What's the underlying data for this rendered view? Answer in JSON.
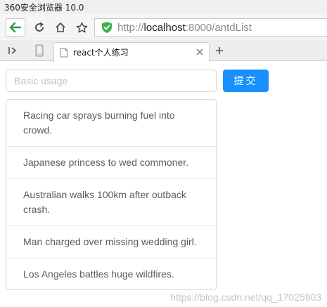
{
  "browser": {
    "window_title": "360安全浏览器 10.0",
    "address": {
      "protocol": "http://",
      "host": "localhost",
      "rest": ":8000/antdList"
    },
    "tab": {
      "title": "react个人练习"
    },
    "icons": [
      "sidebar-toggle-icon",
      "mobile-icon",
      "back-arrow-icon",
      "refresh-icon",
      "home-icon",
      "star-icon",
      "security-shield-icon",
      "page-icon",
      "close-icon",
      "plus-icon"
    ]
  },
  "page": {
    "input_placeholder": "Basic usage",
    "input_value": "",
    "submit_label": "提交",
    "list_items": [
      "Racing car sprays burning fuel into crowd.",
      "Japanese princess to wed commoner.",
      "Australian walks 100km after outback crash.",
      "Man charged over missing wedding girl.",
      "Los Angeles battles huge wildfires."
    ]
  },
  "watermark": "https://blog.csdn.net/qq_17025903",
  "colors": {
    "primary": "#1890ff",
    "shield": "#3db14a",
    "back_arrow": "#2a9d3f"
  }
}
